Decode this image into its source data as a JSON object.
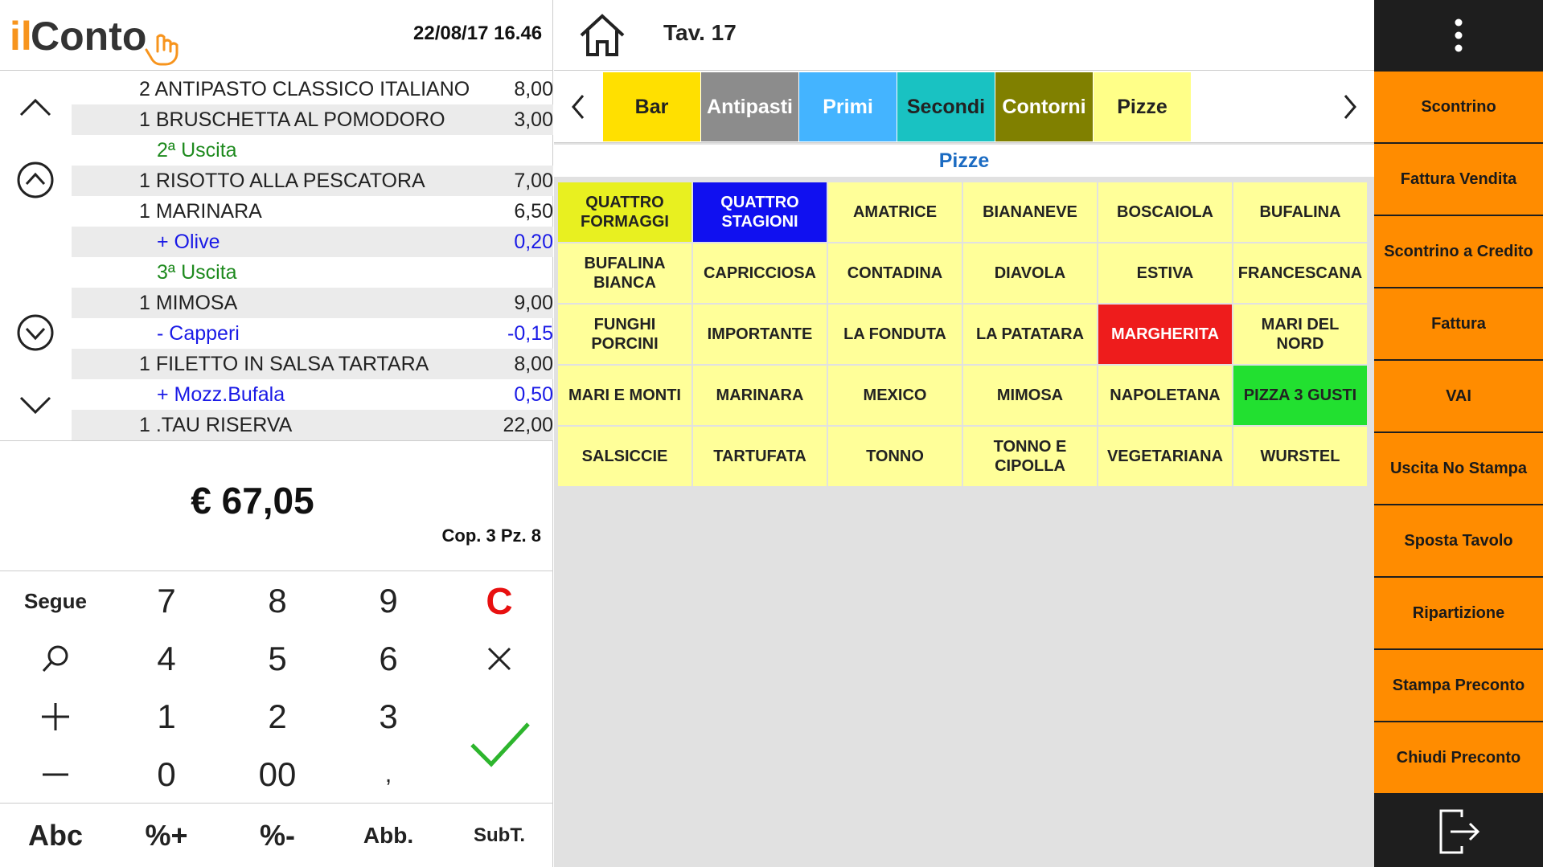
{
  "header": {
    "datetime": "22/08/17 16.46",
    "logo": "ilConto"
  },
  "orders": [
    {
      "desc": "2 ANTIPASTO CLASSICO ITALIANO",
      "price": "8,00",
      "type": "item"
    },
    {
      "desc": "1 BRUSCHETTA AL POMODORO",
      "price": "3,00",
      "type": "item"
    },
    {
      "desc": "2ª Uscita",
      "price": "",
      "type": "course"
    },
    {
      "desc": "1 RISOTTO ALLA PESCATORA",
      "price": "7,00",
      "type": "item"
    },
    {
      "desc": "1 MARINARA",
      "price": "6,50",
      "type": "item"
    },
    {
      "desc": "+ Olive",
      "price": "0,20",
      "type": "mod"
    },
    {
      "desc": "3ª Uscita",
      "price": "",
      "type": "course"
    },
    {
      "desc": "1 MIMOSA",
      "price": "9,00",
      "type": "item"
    },
    {
      "desc": "- Capperi",
      "price": "-0,15",
      "type": "mod"
    },
    {
      "desc": "1 FILETTO IN SALSA TARTARA",
      "price": "8,00",
      "type": "item"
    },
    {
      "desc": "+ Mozz.Bufala",
      "price": "0,50",
      "type": "mod"
    },
    {
      "desc": "1 .TAU RISERVA",
      "price": "22,00",
      "type": "item"
    }
  ],
  "total": "€ 67,05",
  "cop_info": "Cop. 3 Pz. 8",
  "keypad": {
    "segue": "Segue",
    "clear": "C",
    "k7": "7",
    "k8": "8",
    "k9": "9",
    "k4": "4",
    "k5": "5",
    "k6": "6",
    "k1": "1",
    "k2": "2",
    "k3": "3",
    "k0": "0",
    "k00": "00",
    "comma": ","
  },
  "function_keys": [
    "Abc",
    "%+",
    "%-",
    "Abb.",
    "SubT."
  ],
  "table": {
    "label": "Tav. 17"
  },
  "categories": [
    {
      "label": "Bar",
      "color": "#ffe000",
      "text": "#222"
    },
    {
      "label": "Antipasti",
      "color": "#8c8c8c",
      "text": "#ffffff"
    },
    {
      "label": "Primi",
      "color": "#44b4ff",
      "text": "#ffffff"
    },
    {
      "label": "Secondi",
      "color": "#19c2c2",
      "text": "#222"
    },
    {
      "label": "Contorni",
      "color": "#808000",
      "text": "#ffffff"
    },
    {
      "label": "Pizze",
      "color": "#ffff88",
      "text": "#222"
    }
  ],
  "section_title": "Pizze",
  "products": [
    {
      "label": "QUATTRO FORMAGGI",
      "bg": "#e8f020",
      "fg": "#222"
    },
    {
      "label": "QUATTRO STAGIONI",
      "bg": "#1010f0",
      "fg": "#ffffff"
    },
    {
      "label": "AMATRICE",
      "bg": "#ffff99",
      "fg": "#222"
    },
    {
      "label": "BIANANEVE",
      "bg": "#ffff99",
      "fg": "#222"
    },
    {
      "label": "BOSCAIOLA",
      "bg": "#ffff99",
      "fg": "#222"
    },
    {
      "label": "BUFALINA",
      "bg": "#ffff99",
      "fg": "#222"
    },
    {
      "label": "BUFALINA BIANCA",
      "bg": "#ffff99",
      "fg": "#222"
    },
    {
      "label": "CAPRICCIOSA",
      "bg": "#ffff99",
      "fg": "#222"
    },
    {
      "label": "CONTADINA",
      "bg": "#ffff99",
      "fg": "#222"
    },
    {
      "label": "DIAVOLA",
      "bg": "#ffff99",
      "fg": "#222"
    },
    {
      "label": "ESTIVA",
      "bg": "#ffff99",
      "fg": "#222"
    },
    {
      "label": "FRANCESCANA",
      "bg": "#ffff99",
      "fg": "#222"
    },
    {
      "label": "FUNGHI PORCINI",
      "bg": "#ffff99",
      "fg": "#222"
    },
    {
      "label": "IMPORTANTE",
      "bg": "#ffff99",
      "fg": "#222"
    },
    {
      "label": "LA FONDUTA",
      "bg": "#ffff99",
      "fg": "#222"
    },
    {
      "label": "LA PATATARA",
      "bg": "#ffff99",
      "fg": "#222"
    },
    {
      "label": "MARGHERITA",
      "bg": "#ee1c1c",
      "fg": "#ffffff"
    },
    {
      "label": "MARI DEL NORD",
      "bg": "#ffff99",
      "fg": "#222"
    },
    {
      "label": "MARI E MONTI",
      "bg": "#ffff99",
      "fg": "#222"
    },
    {
      "label": "MARINARA",
      "bg": "#ffff99",
      "fg": "#222"
    },
    {
      "label": "MEXICO",
      "bg": "#ffff99",
      "fg": "#222"
    },
    {
      "label": "MIMOSA",
      "bg": "#ffff99",
      "fg": "#222"
    },
    {
      "label": "NAPOLETANA",
      "bg": "#ffff99",
      "fg": "#222"
    },
    {
      "label": "PIZZA 3 GUSTI",
      "bg": "#22e030",
      "fg": "#222"
    },
    {
      "label": "SALSICCIE",
      "bg": "#ffff99",
      "fg": "#222"
    },
    {
      "label": "TARTUFATA",
      "bg": "#ffff99",
      "fg": "#222"
    },
    {
      "label": "TONNO",
      "bg": "#ffff99",
      "fg": "#222"
    },
    {
      "label": "TONNO E CIPOLLA",
      "bg": "#ffff99",
      "fg": "#222"
    },
    {
      "label": "VEGETARIANA",
      "bg": "#ffff99",
      "fg": "#222"
    },
    {
      "label": "WURSTEL",
      "bg": "#ffff99",
      "fg": "#222"
    }
  ],
  "actions": [
    "Scontrino",
    "Fattura Vendita",
    "Scontrino a Credito",
    "Fattura",
    "VAI",
    "Uscita No Stampa",
    "Sposta Tavolo",
    "Ripartizione",
    "Stampa Preconto",
    "Chiudi Preconto"
  ],
  "colors": {
    "accent": "#ff8c00",
    "dark": "#1e1e1e",
    "confirm": "#2db52d",
    "clear": "#e81010",
    "logo_orange": "#f7941d"
  }
}
